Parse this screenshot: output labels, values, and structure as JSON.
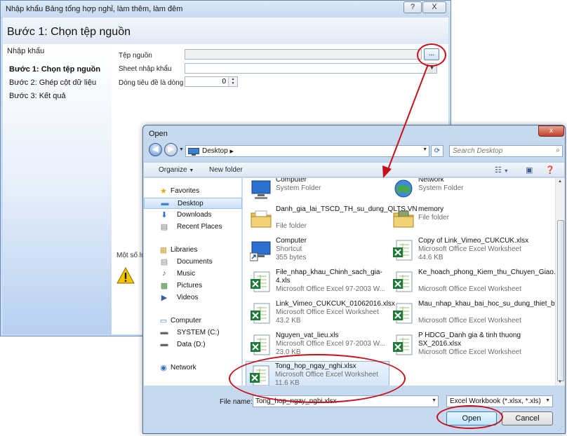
{
  "wizard": {
    "title": "Nhập khẩu Bảng tổng hợp nghỉ, làm thêm, làm đêm",
    "help_label": "?",
    "close_label": "X",
    "step_title": "Bước 1: Chọn tệp nguồn",
    "sidebar": {
      "heading": "Nhập khẩu",
      "steps": [
        {
          "label": "Bước 1: Chọn tệp nguồn",
          "active": true
        },
        {
          "label": "Bước 2: Ghép cột dữ liệu",
          "active": false
        },
        {
          "label": "Bước 3: Kết quả",
          "active": false
        }
      ]
    },
    "form": {
      "source_file_label": "Tệp nguồn",
      "source_file_value": "",
      "browse_label": "...",
      "sheet_label": "Sheet nhập khẩu",
      "sheet_value": "",
      "header_row_label": "Dòng tiêu đề là dòng",
      "header_row_value": "0"
    },
    "note_label": "Một số lưu"
  },
  "dialog": {
    "title": "Open",
    "close_label": "x",
    "address": {
      "path": "Desktop",
      "separator": "▶"
    },
    "search_placeholder": "Search Desktop",
    "toolbar": {
      "organize": "Organize",
      "new_folder": "New folder"
    },
    "nav": {
      "favorites": {
        "label": "Favorites",
        "items": [
          "Desktop",
          "Downloads",
          "Recent Places"
        ]
      },
      "libraries": {
        "label": "Libraries",
        "items": [
          "Documents",
          "Music",
          "Pictures",
          "Videos"
        ]
      },
      "computer": {
        "label": "Computer",
        "items": [
          "SYSTEM (C:)",
          "Data (D:)"
        ]
      },
      "network": {
        "label": "Network"
      }
    },
    "files": [
      {
        "name": "Computer",
        "type": "System Folder",
        "size": "",
        "icon": "computer"
      },
      {
        "name": "Network",
        "type": "System Folder",
        "size": "",
        "icon": "network"
      },
      {
        "name": "Danh_gia_lai_TSCD_TH_su_dung_QLTS.VN",
        "type": "File folder",
        "size": "",
        "icon": "folder"
      },
      {
        "name": "memory",
        "type": "File folder",
        "size": "",
        "icon": "folder"
      },
      {
        "name": "Computer",
        "type": "Shortcut",
        "size": "355 bytes",
        "icon": "computer-shortcut"
      },
      {
        "name": "Copy of Link_Vimeo_CUKCUK.xlsx",
        "type": "Microsoft Office Excel Worksheet",
        "size": "44.6 KB",
        "icon": "excel"
      },
      {
        "name": "File_nhap_khau_Chinh_sach_gia-4.xls",
        "type": "Microsoft Office Excel 97-2003 W...",
        "size": "",
        "icon": "excel"
      },
      {
        "name": "Ke_hoach_phong_Kiem_thu_Chuyen_Giao.xlsx",
        "type": "Microsoft Office Excel Worksheet",
        "size": "",
        "icon": "excel"
      },
      {
        "name": "Link_Vimeo_CUKCUK_01062016.xlsx",
        "type": "Microsoft Office Excel Worksheet",
        "size": "43.2 KB",
        "icon": "excel"
      },
      {
        "name": "Mau_nhap_khau_bai_hoc_su_dung_thiet_bi.xlsx",
        "type": "Microsoft Office Excel Worksheet",
        "size": "",
        "icon": "excel"
      },
      {
        "name": "Nguyen_vat_lieu.xls",
        "type": "Microsoft Office Excel 97-2003 W...",
        "size": "23.0 KB",
        "icon": "excel"
      },
      {
        "name": "P HDCG_Danh gia & tinh thuong SX_2016.xlsx",
        "type": "Microsoft Office Excel Worksheet",
        "size": "",
        "icon": "excel"
      },
      {
        "name": "Tong_hop_ngay_nghi.xlsx",
        "type": "Microsoft Office Excel Worksheet",
        "size": "11.6 KB",
        "icon": "excel",
        "selected": true
      }
    ],
    "file_name_label": "File name:",
    "file_name_value": "Tong_hop_ngay_nghi.xlsx",
    "file_type_value": "Excel Workbook (*.xlsx, *.xls)",
    "open_label": "Open",
    "cancel_label": "Cancel"
  },
  "annotation_color": "#c8101a"
}
